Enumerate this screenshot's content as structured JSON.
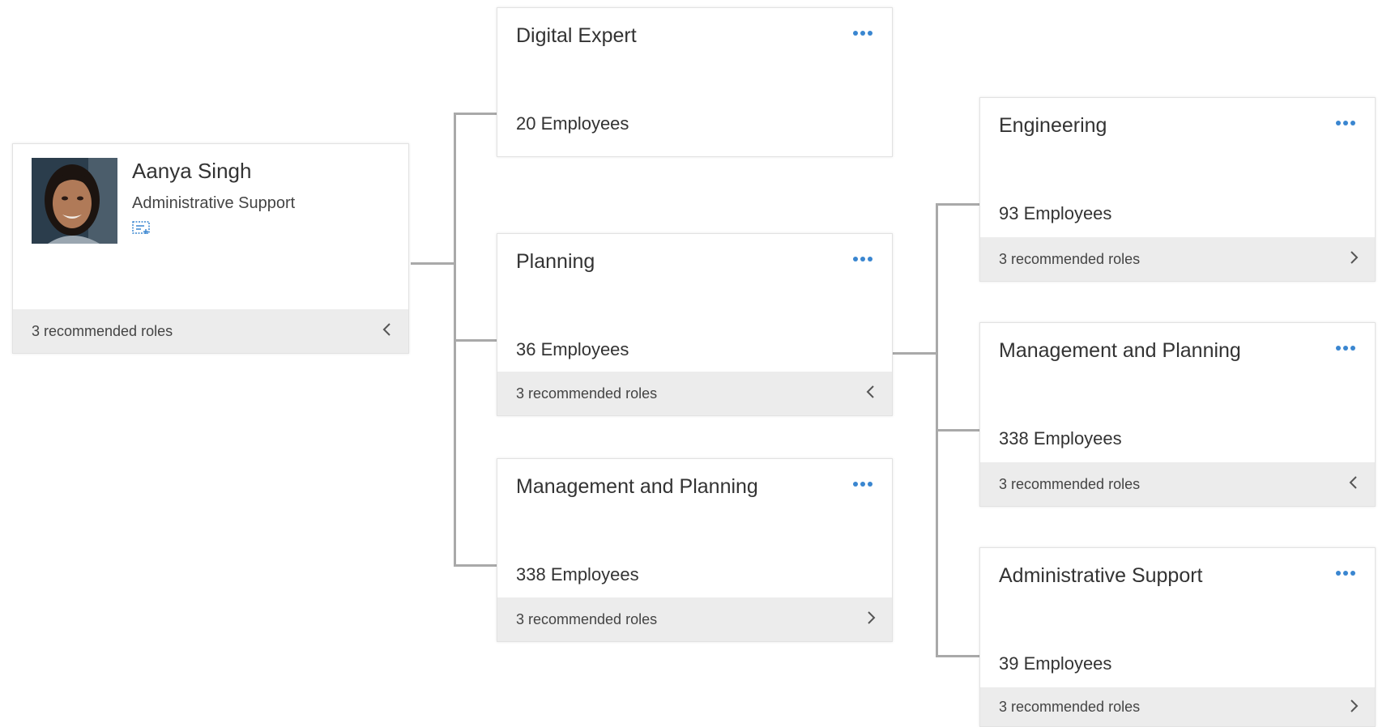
{
  "person": {
    "name": "Aanya Singh",
    "role": "Administrative Support",
    "footer": "3 recommended roles",
    "footer_chevron": "chevron-left-icon"
  },
  "middle_cards": [
    {
      "title": "Digital Expert",
      "count": "20 Employees"
    },
    {
      "title": "Planning",
      "count": "36 Employees",
      "footer": "3 recommended roles",
      "footer_chevron": "chevron-left-icon"
    },
    {
      "title": "Management and Planning",
      "count": "338 Employees",
      "footer": "3 recommended roles",
      "footer_chevron": "chevron-right-icon"
    }
  ],
  "right_cards": [
    {
      "title": "Engineering",
      "count": "93 Employees",
      "footer": "3 recommended roles",
      "footer_chevron": "chevron-right-icon"
    },
    {
      "title": "Management and Planning",
      "count": "338 Employees",
      "footer": "3 recommended roles",
      "footer_chevron": "chevron-left-icon"
    },
    {
      "title": "Administrative Support",
      "count": "39 Employees",
      "footer": "3 recommended roles",
      "footer_chevron": "chevron-right-icon"
    }
  ],
  "colors": {
    "accent": "#3a86d0",
    "connector": "#a9a9a9",
    "footer_bg": "#ececec"
  }
}
